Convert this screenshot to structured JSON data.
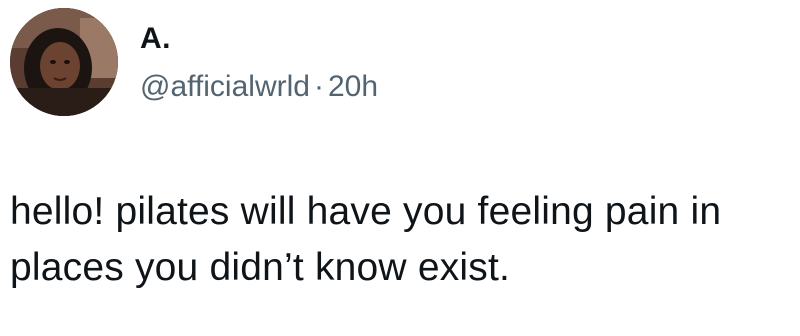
{
  "author": {
    "display_name": "A.",
    "handle": "@afficialwrld",
    "separator": "·",
    "timestamp": "20h"
  },
  "tweet": {
    "text": "hello! pilates will have you feeling pain in places you didn’t know exist."
  },
  "colors": {
    "text": "#0f1419",
    "secondary_text": "#536471",
    "background": "#ffffff"
  }
}
